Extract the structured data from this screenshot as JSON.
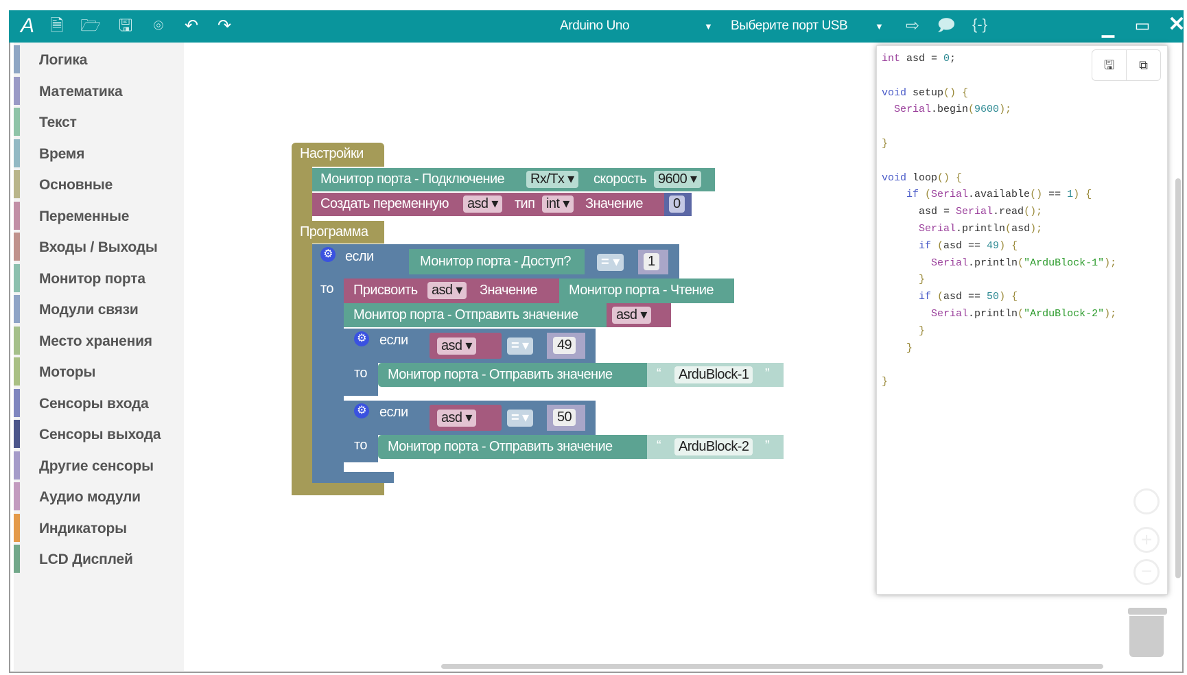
{
  "header": {
    "board": "Arduino Uno",
    "port": "Выберите порт USB",
    "icons": [
      "ardublock-logo-icon",
      "new-file-icon",
      "open-file-icon",
      "save-icon",
      "screenshot-icon",
      "undo-icon",
      "redo-icon"
    ],
    "right_icons": [
      "upload-icon",
      "serial-monitor-icon",
      "code-view-icon"
    ]
  },
  "accent": "#0a959c",
  "sidebar": {
    "items": [
      {
        "label": "Логика",
        "color": "#8ea6c4"
      },
      {
        "label": "Математика",
        "color": "#9a9ac6"
      },
      {
        "label": "Текст",
        "color": "#8fc4a8"
      },
      {
        "label": "Время",
        "color": "#93b9c4"
      },
      {
        "label": "Основные",
        "color": "#b9b58a"
      },
      {
        "label": "Переменные",
        "color": "#c28fa6"
      },
      {
        "label": "Входы / Выходы",
        "color": "#c0928c"
      },
      {
        "label": "Монитор порта",
        "color": "#8cc0ae"
      },
      {
        "label": "Модули связи",
        "color": "#8fa4c6"
      },
      {
        "label": "Место хранения",
        "color": "#a5c08a"
      },
      {
        "label": "Моторы",
        "color": "#a9c084"
      },
      {
        "label": "Сенсоры входа",
        "color": "#7f86bf"
      },
      {
        "label": "Сенсоры выхода",
        "color": "#4c568b"
      },
      {
        "label": "Другие сенсоры",
        "color": "#a59bc9"
      },
      {
        "label": "Аудио модули",
        "color": "#c39bbf"
      },
      {
        "label": "Индикаторы",
        "color": "#e49a4a"
      },
      {
        "label": "LCD Дисплей",
        "color": "#72a88a"
      }
    ]
  },
  "blocks": {
    "setup": "Настройки",
    "program": "Программа",
    "serial_connect": "Монитор порта - Подключение",
    "rxtx": "Rx/Tx",
    "speed_label": "скорость",
    "speed": "9600",
    "create_var": "Создать переменную",
    "var": "asd",
    "type_label": "тип",
    "type": "int",
    "value_label": "Значение",
    "init": "0",
    "if": "если",
    "then": "то",
    "serial_available": "Монитор порта - Доступ?",
    "eq": "=",
    "one": "1",
    "assign": "Присвоить",
    "serial_read": "Монитор порта - Чтение",
    "serial_send": "Монитор порта - Отправить значение",
    "n49": "49",
    "n50": "50",
    "str1": "ArduBlock-1",
    "str2": "ArduBlock-2",
    "oq": "“",
    "cq": "”"
  },
  "code": [
    [
      [
        "int",
        "k"
      ],
      [
        " asd = ",
        ""
      ],
      [
        "0",
        "n"
      ],
      [
        ";",
        ""
      ]
    ],
    [],
    [
      [
        "void",
        "v"
      ],
      [
        " setup",
        ""
      ],
      [
        "() {",
        "p"
      ]
    ],
    [
      [
        "  Serial",
        "k"
      ],
      [
        ".begin",
        ""
      ],
      [
        "(",
        "p"
      ],
      [
        "9600",
        "n"
      ],
      [
        ");",
        "p"
      ]
    ],
    [],
    [
      [
        "}",
        "p"
      ]
    ],
    [],
    [
      [
        "void",
        "v"
      ],
      [
        " loop",
        ""
      ],
      [
        "() {",
        "p"
      ]
    ],
    [
      [
        "    if",
        "v"
      ],
      [
        " (",
        "p"
      ],
      [
        "Serial",
        "k"
      ],
      [
        ".available",
        ""
      ],
      [
        "()",
        "p"
      ],
      [
        " == ",
        ""
      ],
      [
        "1",
        "n"
      ],
      [
        ") {",
        "p"
      ]
    ],
    [
      [
        "      asd = ",
        ""
      ],
      [
        "Serial",
        "k"
      ],
      [
        ".read",
        ""
      ],
      [
        "();",
        "p"
      ]
    ],
    [
      [
        "      Serial",
        "k"
      ],
      [
        ".println",
        ""
      ],
      [
        "(",
        "p"
      ],
      [
        "asd",
        ""
      ],
      [
        ");",
        "p"
      ]
    ],
    [
      [
        "      if",
        "v"
      ],
      [
        " (",
        "p"
      ],
      [
        "asd == ",
        ""
      ],
      [
        "49",
        "n"
      ],
      [
        ") {",
        "p"
      ]
    ],
    [
      [
        "        Serial",
        "k"
      ],
      [
        ".println",
        ""
      ],
      [
        "(",
        "p"
      ],
      [
        "\"ArduBlock-1\"",
        "s"
      ],
      [
        ");",
        "p"
      ]
    ],
    [
      [
        "      }",
        "p"
      ]
    ],
    [
      [
        "      if",
        "v"
      ],
      [
        " (",
        "p"
      ],
      [
        "asd == ",
        ""
      ],
      [
        "50",
        "n"
      ],
      [
        ") {",
        "p"
      ]
    ],
    [
      [
        "        Serial",
        "k"
      ],
      [
        ".println",
        ""
      ],
      [
        "(",
        "p"
      ],
      [
        "\"ArduBlock-2\"",
        "s"
      ],
      [
        ");",
        "p"
      ]
    ],
    [
      [
        "      }",
        "p"
      ]
    ],
    [
      [
        "    }",
        "p"
      ]
    ],
    [],
    [
      [
        "}",
        "p"
      ]
    ]
  ]
}
